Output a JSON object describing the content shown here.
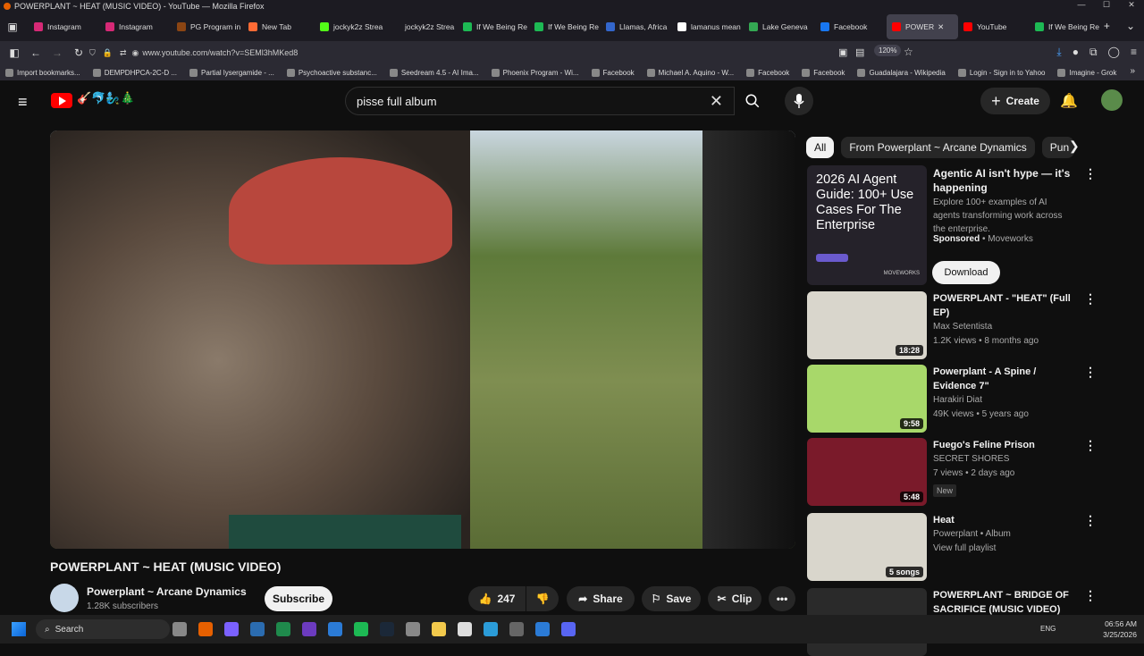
{
  "window": {
    "title": "POWERPLANT ~ HEAT (MUSIC VIDEO) - YouTube — Mozilla Firefox"
  },
  "tabs": [
    {
      "label": "Instagram",
      "color": "#d62976"
    },
    {
      "label": "Instagram",
      "color": "#d62976"
    },
    {
      "label": "PG Program in",
      "color": "#8b4513"
    },
    {
      "label": "New Tab",
      "color": "#ff6b35"
    },
    {
      "label": "jockyk2z Strea",
      "color": "#53fc18"
    },
    {
      "label": "jockyk2z Strea",
      "color": "#1c1b22"
    },
    {
      "label": "If We Being Re",
      "color": "#1db954"
    },
    {
      "label": "If We Being Re",
      "color": "#1db954"
    },
    {
      "label": "Llamas, Africa",
      "color": "#3366cc"
    },
    {
      "label": "lamanus mean",
      "color": "#ffffff"
    },
    {
      "label": "Lake Geneva",
      "color": "#34a853"
    },
    {
      "label": "Facebook",
      "color": "#1877f2"
    },
    {
      "label": "POWER",
      "color": "#ff0000",
      "active": true
    },
    {
      "label": "YouTube",
      "color": "#ff0000"
    },
    {
      "label": "If We Being Re",
      "color": "#1db954"
    }
  ],
  "nav": {
    "url": "www.youtube.com/watch?v=SEMl3hMKed8",
    "zoom": "120%"
  },
  "bookmarks": [
    "Import bookmarks...",
    "DEMPDHPCA-2C-D ...",
    "Partial lysergamide - ...",
    "Psychoactive substanc...",
    "Seedream 4.5 - AI Ima...",
    "Phoenix Program - Wi...",
    "Facebook",
    "Michael A. Aquino - W...",
    "Facebook",
    "Facebook",
    "Guadalajara - Wikipedia",
    "Login - Sign in to Yahoo",
    "Imagine - Grok"
  ],
  "header": {
    "search_value": "pisse full album",
    "create_label": "Create",
    "doodle": "🎸🐬🧞‍♂️🎄"
  },
  "video": {
    "title": "POWERPLANT ~ HEAT (MUSIC VIDEO)",
    "channel": "Powerplant ~ Arcane Dynamics",
    "subscribers": "1.28K subscribers",
    "subscribe_label": "Subscribe",
    "likes": "247",
    "share_label": "Share",
    "save_label": "Save",
    "clip_label": "Clip"
  },
  "chips": [
    "All",
    "From Powerplant ~ Arcane Dynamics",
    "Pun"
  ],
  "ad": {
    "thumb_text": "2026 AI Agent Guide: 100+ Use Cases For The Enterprise",
    "title": "Agentic AI isn't hype — it's happening",
    "description": "Explore 100+ examples of AI agents transforming work across the enterprise.",
    "sponsored": "Sponsored",
    "advertiser": "Moveworks",
    "brand_mark": "MOVEWORKS",
    "cta": "Download"
  },
  "recommendations": [
    {
      "title": "POWERPLANT - \"HEAT\" (Full EP)",
      "channel": "Max Setentista",
      "meta": "1.2K views • 8 months ago",
      "duration": "18:28",
      "thumb_bg": "#d9d6cc",
      "new": false
    },
    {
      "title": "Powerplant - A Spine / Evidence 7\"",
      "channel": "Harakiri Diat",
      "meta": "49K views • 5 years ago",
      "duration": "9:58",
      "thumb_bg": "#a8d86a",
      "new": false
    },
    {
      "title": "Fuego's Feline Prison",
      "channel": "SECRET SHORES",
      "meta": "7 views • 2 days ago",
      "duration": "5:48",
      "thumb_bg": "#7a1a2a",
      "new": true,
      "new_label": "New"
    },
    {
      "title": "Heat",
      "channel": "Powerplant • Album",
      "meta": "View full playlist",
      "duration": "5 songs",
      "thumb_bg": "#d9d6cc",
      "new": false
    },
    {
      "title": "POWERPLANT ~ BRIDGE OF SACRIFICE (MUSIC VIDEO)",
      "channel": "",
      "meta": "",
      "duration": "",
      "thumb_bg": "#2a2a2a",
      "new": false
    }
  ],
  "taskbar": {
    "search": "Search",
    "time": "06:56 AM",
    "date": "3/25/2026",
    "lang": "ENG"
  }
}
